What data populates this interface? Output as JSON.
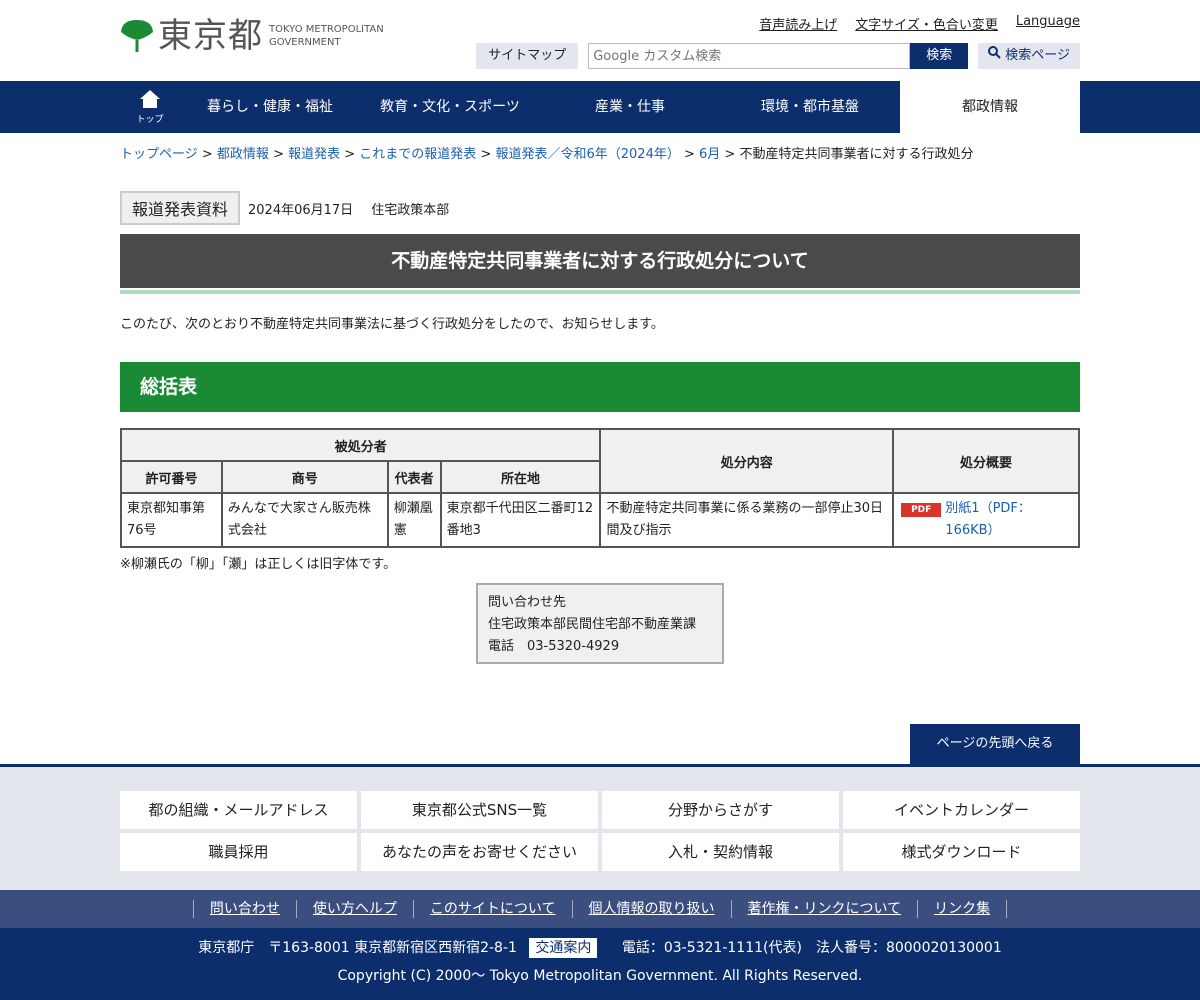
{
  "header": {
    "logo_jp": "東京都",
    "logo_en_1": "TOKYO METROPOLITAN",
    "logo_en_2": "GOVERNMENT",
    "util_links": [
      "音声読み上げ",
      "文字サイズ・色合い変更",
      "Language"
    ],
    "sitemap_label": "サイトマップ",
    "search_placeholder": "Google カスタム検索",
    "search_button": "検索",
    "search_page_button": "検索ページ"
  },
  "nav": {
    "home_label": "トップ",
    "items": [
      "暮らし・健康・福祉",
      "教育・文化・スポーツ",
      "産業・仕事",
      "環境・都市基盤",
      "都政情報"
    ],
    "active_index": 4
  },
  "breadcrumb": {
    "links": [
      "トップページ",
      "都政情報",
      "報道発表",
      "これまでの報道発表",
      "報道発表／令和6年（2024年）",
      "6月"
    ],
    "current": "不動産特定共同事業者に対する行政処分"
  },
  "meta": {
    "badge": "報道発表資料",
    "date": "2024年06月17日",
    "department": "住宅政策本部"
  },
  "title": "不動産特定共同事業者に対する行政処分について",
  "intro": "このたび、次のとおり不動産特定共同事業法に基づく行政処分をしたので、お知らせします。",
  "section_heading": "総括表",
  "table": {
    "group_header": "被処分者",
    "headers": [
      "許可番号",
      "商号",
      "代表者",
      "所在地"
    ],
    "header_content": "処分内容",
    "header_summary": "処分概要",
    "row": {
      "license": "東京都知事第76号",
      "company": "みんなで大家さん販売株式会社",
      "representative": "柳瀬凰憲",
      "address": "東京都千代田区二番町12番地3",
      "content": "不動産特定共同事業に係る業務の一部停止30日間及び指示",
      "pdf_tag": "PDF",
      "pdf_link": "別紙1（PDF：166KB）"
    }
  },
  "note": "※柳瀬氏の「柳」「瀬」は正しくは旧字体です。",
  "contact": {
    "label": "問い合わせ先",
    "dept": "住宅政策本部民間住宅部不動産業課",
    "phone": "電話　03-5320-4929"
  },
  "back_to_top": "ページの先頭へ戻る",
  "footer": {
    "grid": [
      "都の組織・メールアドレス",
      "東京都公式SNS一覧",
      "分野からさがす",
      "イベントカレンダー",
      "職員採用",
      "あなたの声をお寄せください",
      "入札・契約情報",
      "様式ダウンロード"
    ],
    "links": [
      "問い合わせ",
      "使い方ヘルプ",
      "このサイトについて",
      "個人情報の取り扱い",
      "著作権・リンクについて",
      "リンク集"
    ],
    "address": "東京都庁　〒163-8001 東京都新宿区西新宿2-8-1",
    "access_label": "交通案内",
    "phone": "電話：03-5321-1111(代表)　法人番号：8000020130001",
    "copyright": "Copyright (C) 2000～ Tokyo Metropolitan Government. All Rights Reserved."
  },
  "colors": {
    "navy": "#0d2e6d",
    "green": "#1b8a35",
    "title_gray": "#4a4a4a",
    "link_blue": "#1b5fae",
    "pdf_red": "#d9342b"
  }
}
